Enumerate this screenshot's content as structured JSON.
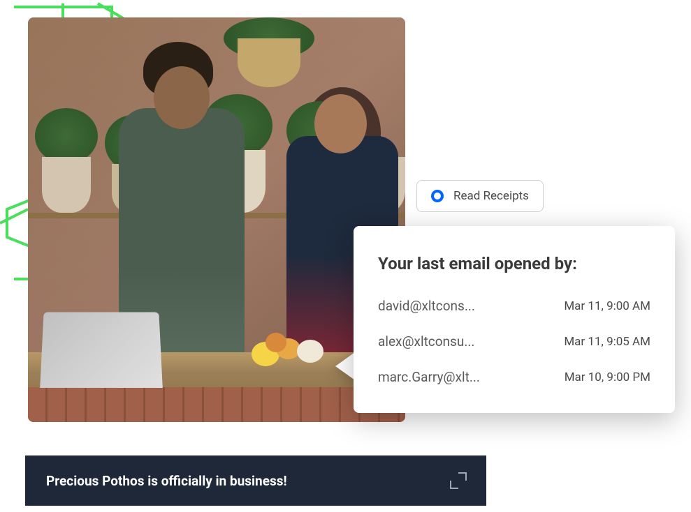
{
  "badge": {
    "label": "Read Receipts"
  },
  "card": {
    "title": "Your last email opened by:",
    "rows": [
      {
        "email": "david@xltcons...",
        "time": "Mar 11, 9:00 AM"
      },
      {
        "email": "alex@xltconsu...",
        "time": "Mar 11, 9:05 AM"
      },
      {
        "email": "marc.Garry@xlt...",
        "time": "Mar 10, 9:00 PM"
      }
    ]
  },
  "banner": {
    "text": "Precious Pothos is officially in business!"
  }
}
